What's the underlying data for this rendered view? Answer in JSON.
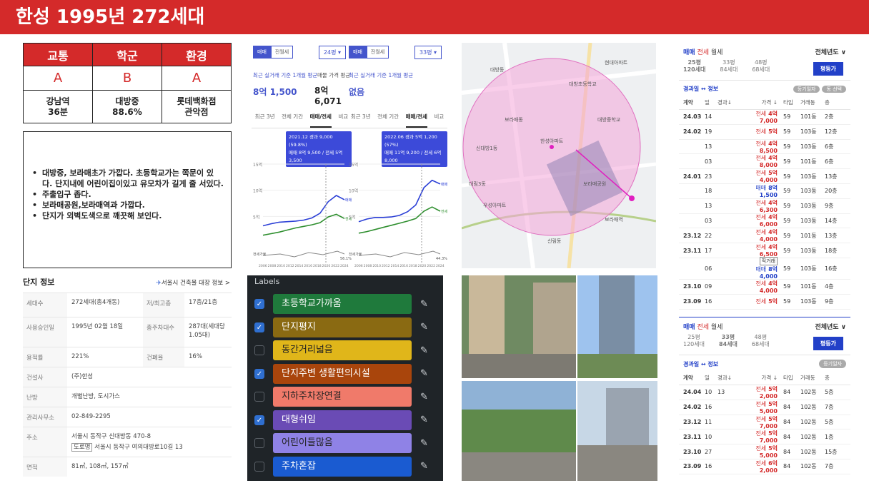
{
  "title": "한성 1995년 272세대",
  "score": {
    "heads": [
      "교통",
      "학군",
      "환경"
    ],
    "grades": [
      "A",
      "B",
      "A"
    ],
    "details": [
      [
        "강남역",
        "36분"
      ],
      [
        "대방중",
        "88.6%"
      ],
      [
        "롯데백화점",
        "관악점"
      ]
    ]
  },
  "notes": [
    "대방중, 보라매초가 가깝다. 초등학교가는 쪽문이 있다. 단지내에 어린이집이있고 유모차가 길게 줄 서있다.",
    "주출입구 좁다.",
    "보라매공원,보라매역과 가깝다.",
    "단지가 외벽도색으로 깨끗해 보인다."
  ],
  "info": {
    "title": "단지 정보",
    "link": "서울시 건축물 대장 정보 >",
    "rows": [
      {
        "k": "세대수",
        "v": "272세대(총4개동)",
        "k2": "저/최고층",
        "v2": "17층/21층"
      },
      {
        "k": "사용승인일",
        "v": "1995년 02월 18일",
        "k2": "총주차대수",
        "v2": "287대(세대당 1.05대)"
      },
      {
        "k": "용적률",
        "v": "221%",
        "k2": "건폐율",
        "v2": "16%"
      },
      {
        "k": "건설사",
        "v": "(주)한성"
      },
      {
        "k": "난방",
        "v": "개별난방, 도시가스"
      },
      {
        "k": "관리사무소",
        "v": "02-849-2295"
      },
      {
        "k": "주소",
        "v": "서울시 동작구 신대방동 470-8",
        "v_b": "도로명",
        "v_c": "서울시 동작구 여의대방로10길 13"
      },
      {
        "k": "면적",
        "v": "81㎡, 108㎡, 157㎡"
      }
    ]
  },
  "chart_data": [
    {
      "type": "line",
      "size": "24평",
      "toggle": [
        "매매",
        "전월세"
      ],
      "recent_label": "최근 실거래 기준 1개월 평균",
      "sale_value": "8억 1,500",
      "ask_label": "매물 가격 평균",
      "ask_value": "8억 6,071",
      "tabs": [
        "최근 3년",
        "전체 기간",
        "매매/전세",
        "비교"
      ],
      "tooltip": [
        "2021.12 경과 9,000 (59.8%)",
        "매매 8억 9,500 / 전세 5억 3,500"
      ],
      "ylabels": [
        "15억",
        "10억",
        "5억"
      ],
      "xlabels": [
        "2006",
        "2008",
        "2010",
        "2012",
        "2014",
        "2016",
        "2018",
        "2020",
        "2022",
        "2024"
      ],
      "series": [
        {
          "name": "매매",
          "values": [
            3.2,
            3.6,
            3.9,
            4.0,
            4.1,
            4.3,
            4.7,
            5.6,
            7.8,
            9.0,
            8.2
          ]
        },
        {
          "name": "전세",
          "values": [
            1.4,
            1.7,
            2.0,
            2.4,
            2.8,
            3.1,
            3.4,
            3.8,
            4.9,
            5.4,
            4.6
          ]
        }
      ],
      "lower_label": "전세가율",
      "lower_value": "56.1%"
    },
    {
      "type": "line",
      "size": "33평",
      "toggle": [
        "매매",
        "전월세"
      ],
      "recent_label": "최근 실거래 기준 1개월 평균",
      "sale_value": "없음",
      "tabs": [
        "최근 3년",
        "전체 기간",
        "매매/전세",
        "비교"
      ],
      "tooltip": [
        "2022.06 경과 5억 1,200 (57%)",
        "매매 11억 9,200 / 전세 6억 8,000"
      ],
      "ylabels": [
        "15억",
        "10억",
        "5억"
      ],
      "xlabels": [
        "2006",
        "2008",
        "2010",
        "2012",
        "2014",
        "2016",
        "2018",
        "2020",
        "2022",
        "2024"
      ],
      "series": [
        {
          "name": "매매",
          "values": [
            4.0,
            4.5,
            4.8,
            4.8,
            4.9,
            5.2,
            5.9,
            7.2,
            10.5,
            11.9,
            11.2
          ]
        },
        {
          "name": "전세",
          "values": [
            1.8,
            2.1,
            2.5,
            2.9,
            3.3,
            3.7,
            4.1,
            4.6,
            6.0,
            6.8,
            6.0
          ]
        }
      ],
      "lower_label": "전세가율",
      "lower_value": "44.3%"
    }
  ],
  "map": {
    "labels": [
      "대방동",
      "대방초등학교",
      "대방중학교",
      "신대방1동",
      "보라매동",
      "보라매공원",
      "보라매역",
      "신림동",
      "한성아파트",
      "우성아파트",
      "현대아파트",
      "대림3동"
    ]
  },
  "labels_panel": {
    "title": "Labels",
    "items": [
      {
        "text": "초등학교가까움",
        "checked": true,
        "color": "#1f7a3c"
      },
      {
        "text": "단지평지",
        "checked": true,
        "color": "#8a6a12"
      },
      {
        "text": "동간거리넓음",
        "checked": false,
        "color": "#e0b61a"
      },
      {
        "text": "단지주변 생활편의시설",
        "checked": true,
        "color": "#a9450c"
      },
      {
        "text": "지하주차장연결",
        "checked": false,
        "color": "#f07a6a"
      },
      {
        "text": "대형쉬임",
        "checked": true,
        "color": "#6a4bb5"
      },
      {
        "text": "어린이들많음",
        "checked": false,
        "color": "#8f82e6"
      },
      {
        "text": "주차혼잡",
        "checked": false,
        "color": "#1a5bd1"
      }
    ]
  },
  "tx1": {
    "tabs": [
      "매매",
      "전세",
      "월세"
    ],
    "year_sel": "전체년도 ∨",
    "sizes": [
      {
        "a": "25평",
        "b": "120세대",
        "on": true
      },
      {
        "a": "33평",
        "b": "84세대",
        "on": false
      },
      {
        "a": "48평",
        "b": "68세대",
        "on": false
      }
    ],
    "btn": "평등가",
    "sub": "경과일 ↔ 정보",
    "pill1": "등기일자",
    "pill2": "동 선택",
    "cols": [
      "계약",
      "일",
      "경과↓",
      "가격 ↓",
      "타입",
      "거래동",
      "층"
    ],
    "rows": [
      {
        "d": "24.03",
        "day": "14",
        "t": "전세",
        "p": "4억 7,000",
        "tp": "59",
        "dong": "101동",
        "f": "2층",
        "c": "red"
      },
      {
        "d": "24.02",
        "day": "19",
        "t": "전세",
        "p": "5억",
        "tp": "59",
        "dong": "103동",
        "f": "12층",
        "c": "red"
      },
      {
        "d": "",
        "day": "13",
        "t": "전세",
        "p": "4억 8,500",
        "tp": "59",
        "dong": "103동",
        "f": "6층",
        "c": "red"
      },
      {
        "d": "",
        "day": "03",
        "t": "전세",
        "p": "4억 8,000",
        "tp": "59",
        "dong": "101동",
        "f": "6층",
        "c": "red"
      },
      {
        "d": "24.01",
        "day": "23",
        "t": "전세",
        "p": "5억 4,000",
        "tp": "59",
        "dong": "103동",
        "f": "13층",
        "c": "red"
      },
      {
        "d": "",
        "day": "18",
        "t": "매매",
        "p": "8억 1,500",
        "tp": "59",
        "dong": "103동",
        "f": "20층",
        "c": "blue"
      },
      {
        "d": "",
        "day": "13",
        "t": "전세",
        "p": "4억 6,300",
        "tp": "59",
        "dong": "103동",
        "f": "9층",
        "c": "red"
      },
      {
        "d": "",
        "day": "03",
        "t": "전세",
        "p": "4억 6,000",
        "tp": "59",
        "dong": "103동",
        "f": "14층",
        "c": "red"
      },
      {
        "d": "23.12",
        "day": "22",
        "t": "전세",
        "p": "4억 4,000",
        "tp": "59",
        "dong": "101동",
        "f": "13층",
        "c": "red"
      },
      {
        "d": "23.11",
        "day": "17",
        "t": "전세",
        "p": "4억 6,500",
        "tp": "59",
        "dong": "103동",
        "f": "18층",
        "c": "red"
      },
      {
        "d": "",
        "day": "06",
        "t": "매매",
        "p": "8억 4,000",
        "tp": "59",
        "dong": "103동",
        "f": "16층",
        "c": "blue",
        "tag": "직거래"
      },
      {
        "d": "23.10",
        "day": "09",
        "t": "전세",
        "p": "4억 4,000",
        "tp": "59",
        "dong": "101동",
        "f": "4층",
        "c": "red"
      },
      {
        "d": "23.09",
        "day": "16",
        "t": "전세",
        "p": "5억",
        "tp": "59",
        "dong": "103동",
        "f": "9층",
        "c": "red"
      }
    ]
  },
  "tx2": {
    "tabs": [
      "매매",
      "전세",
      "월세"
    ],
    "year_sel": "전체년도 ∨",
    "sizes": [
      {
        "a": "25평",
        "b": "120세대",
        "on": false
      },
      {
        "a": "33평",
        "b": "84세대",
        "on": true
      },
      {
        "a": "48평",
        "b": "68세대",
        "on": false
      }
    ],
    "btn": "평등가",
    "sub": "경과일 ↔ 정보",
    "pill1": "등기일자",
    "cols": [
      "계약",
      "일",
      "경과↓",
      "가격 ↓",
      "타입",
      "거래동",
      "층"
    ],
    "rows": [
      {
        "d": "24.04",
        "day": "10",
        "n": "13",
        "t": "전세",
        "p": "5억 2,000",
        "tp": "84",
        "dong": "102동",
        "f": "5층",
        "c": "red"
      },
      {
        "d": "24.02",
        "day": "16",
        "t": "전세",
        "p": "5억 5,000",
        "tp": "84",
        "dong": "102동",
        "f": "7층",
        "c": "red"
      },
      {
        "d": "23.12",
        "day": "11",
        "t": "전세",
        "p": "5억 7,000",
        "tp": "84",
        "dong": "102동",
        "f": "5층",
        "c": "red"
      },
      {
        "d": "23.11",
        "day": "10",
        "t": "전세",
        "p": "5억 7,000",
        "tp": "84",
        "dong": "102동",
        "f": "1층",
        "c": "red"
      },
      {
        "d": "23.10",
        "day": "27",
        "t": "전세",
        "p": "5억 5,000",
        "tp": "84",
        "dong": "102동",
        "f": "15층",
        "c": "red"
      },
      {
        "d": "23.09",
        "day": "16",
        "t": "전세",
        "p": "6억 2,000",
        "tp": "84",
        "dong": "102동",
        "f": "7층",
        "c": "red"
      }
    ]
  }
}
